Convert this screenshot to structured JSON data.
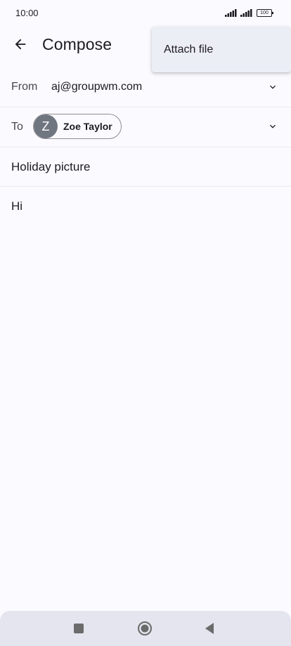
{
  "status_bar": {
    "time": "10:00",
    "battery": "100",
    "icons": [
      "signal-icon",
      "signal-icon",
      "battery-icon"
    ]
  },
  "app_bar": {
    "title": "Compose",
    "back_icon": "arrow-left-icon"
  },
  "menu": {
    "items": [
      {
        "label": "Attach file"
      }
    ]
  },
  "compose": {
    "from_label": "From",
    "from_value": "aj@groupwm.com",
    "to_label": "To",
    "recipient": {
      "initial": "Z",
      "name": "Zoe Taylor"
    },
    "subject": "Holiday picture",
    "body": "Hi"
  },
  "nav_bar": {
    "icons": [
      "recents-square-icon",
      "home-circle-icon",
      "back-triangle-icon"
    ]
  },
  "colors": {
    "background": "#fbfafe",
    "menu_background": "#eceef6",
    "avatar": "#6f7680",
    "nav_bar": "#e4e5ef"
  }
}
